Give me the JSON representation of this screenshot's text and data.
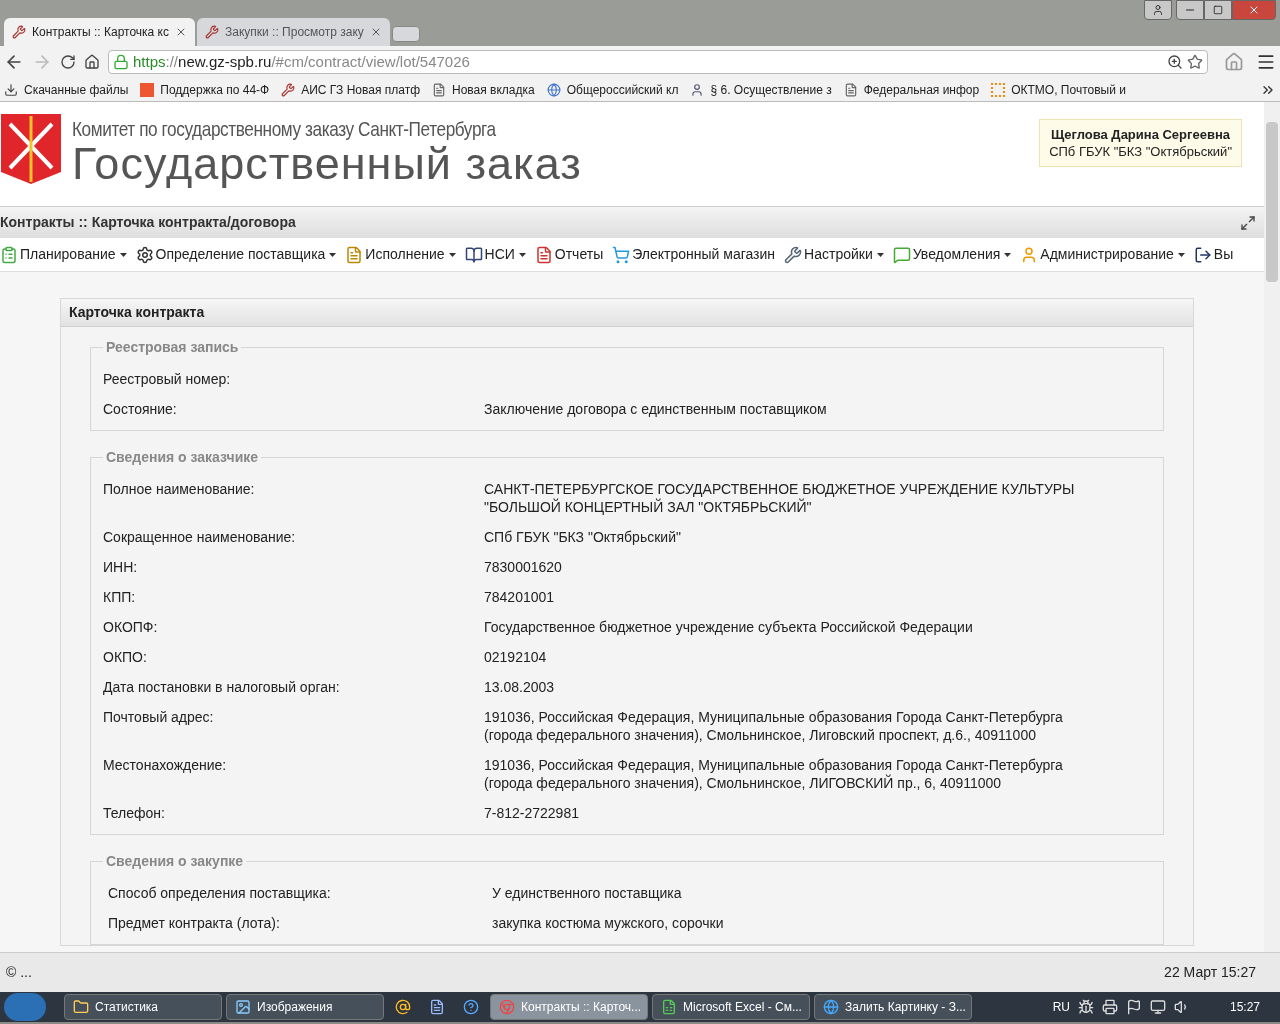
{
  "browser": {
    "tabs": [
      {
        "title": "Контракты :: Карточка кс",
        "selected": true
      },
      {
        "title": "Закупки :: Просмотр заку",
        "selected": false
      }
    ],
    "address": {
      "scheme": "https",
      "rest": "://",
      "host": "new.gz-spb.ru",
      "path": "/#cm/contract/view/lot/547026"
    },
    "bookmarks": [
      {
        "label": "Скачанные файлы",
        "kind": "download"
      },
      {
        "label": "Поддержка по 44-Ф",
        "kind": "badge"
      },
      {
        "label": "АИС ГЗ Новая платф",
        "kind": "tool"
      },
      {
        "label": "Новая вкладка",
        "kind": "page"
      },
      {
        "label": "Общероссийский кл",
        "kind": "globe"
      },
      {
        "label": "§ 6. Осуществление з",
        "kind": "person"
      },
      {
        "label": "Федеральная инфор",
        "kind": "page"
      },
      {
        "label": "ОКТМО, Почтовый и",
        "kind": "code"
      }
    ]
  },
  "header": {
    "org": "Комитет по государственному заказу Санкт-Петербурга",
    "title": "Государственный заказ"
  },
  "user": {
    "name": "Щеглова Дарина Сергеевна",
    "org": "СПб ГБУК \"БКЗ \"Октябрьский\""
  },
  "breadcrumb": "Контракты :: Карточка контракта/договора",
  "menu": [
    {
      "label": "Планирование",
      "kind": "plan",
      "dropdown": true
    },
    {
      "label": "Определение поставщика",
      "kind": "gears",
      "dropdown": true
    },
    {
      "label": "Исполнение",
      "kind": "exec",
      "dropdown": true
    },
    {
      "label": "НСИ",
      "kind": "book",
      "dropdown": true
    },
    {
      "label": "Отчеты",
      "kind": "report",
      "dropdown": false
    },
    {
      "label": "Электронный магазин",
      "kind": "cart",
      "dropdown": false
    },
    {
      "label": "Настройки",
      "kind": "wrench",
      "dropdown": true
    },
    {
      "label": "Уведомления",
      "kind": "note",
      "dropdown": true
    },
    {
      "label": "Администрирование",
      "kind": "user",
      "dropdown": true
    },
    {
      "label": "Вы",
      "kind": "exit",
      "dropdown": false
    }
  ],
  "card": {
    "title": "Карточка контракта",
    "sections": [
      {
        "title": "Реестровая запись",
        "rows": [
          {
            "label": "Реестровый номер:"
          },
          {
            "label": "Состояние:",
            "value": "Заключение договора с единственным поставщиком"
          }
        ]
      },
      {
        "title": "Сведения о заказчике",
        "rows": [
          {
            "label": "Полное наименование:",
            "value": "САНКТ-ПЕТЕРБУРГСКОЕ ГОСУДАРСТВЕННОЕ БЮДЖЕТНОЕ УЧРЕЖДЕНИЕ КУЛЬТУРЫ \"БОЛЬШОЙ КОНЦЕРТНЫЙ ЗАЛ \"ОКТЯБРЬСКИЙ\""
          },
          {
            "label": "Сокращенное наименование:",
            "value": "СПб ГБУК \"БКЗ \"Октябрьский\""
          },
          {
            "label": "ИНН:",
            "value": "7830001620"
          },
          {
            "label": "КПП:",
            "value": "784201001"
          },
          {
            "label": "ОКОПФ:",
            "value": "Государственное бюджетное учреждение субъекта Российской Федерации"
          },
          {
            "label": "ОКПО:",
            "value": "02192104"
          },
          {
            "label": "Дата постановки в налоговый орган:",
            "value": "13.08.2003"
          },
          {
            "label": "Почтовый адрес:",
            "value": "191036, Российская Федерация, Муниципальные образования Города Санкт-Петербурга (города федерального значения), Смольнинское, Лиговский проспект, д.6., 40911000"
          },
          {
            "label": "Местонахождение:",
            "value": "191036, Российская Федерация, Муниципальные образования Города Санкт-Петербурга (города федерального значения), Смольнинское, ЛИГОВСКИЙ пр., 6, 40911000"
          },
          {
            "label": "Телефон:",
            "value": "7-812-2722981"
          }
        ]
      },
      {
        "title": "Сведения о закупке",
        "rows": [
          {
            "label": "Способ определения поставщика:",
            "value": "У единственного поставщика"
          },
          {
            "label": "Предмет контракта (лота):",
            "value": "закупка костюма мужского, сорочки"
          }
        ]
      }
    ]
  },
  "status_bar": {
    "left": "© ...",
    "right": "22 Март 15:27"
  },
  "taskbar": {
    "items": [
      {
        "label": "Статистика",
        "kind": "folder",
        "selected": false
      },
      {
        "label": "Изображения",
        "kind": "images",
        "selected": false
      },
      {
        "kind": "mail"
      },
      {
        "kind": "word"
      },
      {
        "kind": "help"
      },
      {
        "label": "Контракты :: Карточ...",
        "kind": "chrome",
        "selected": true
      },
      {
        "label": "Microsoft Excel - См...",
        "kind": "excel",
        "selected": false
      },
      {
        "label": "Залить Картинку - З...",
        "kind": "ie",
        "selected": false
      }
    ],
    "language": "RU",
    "clock": "15:27"
  }
}
